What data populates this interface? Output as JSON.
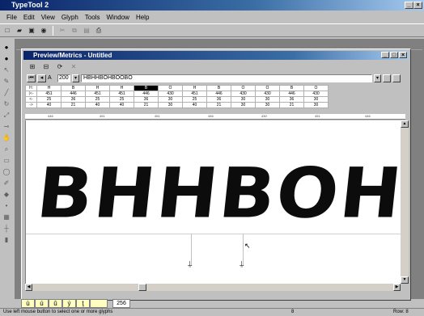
{
  "app": {
    "title": "TypeTool 2"
  },
  "menu": [
    "File",
    "Edit",
    "View",
    "Glyph",
    "Tools",
    "Window",
    "Help"
  ],
  "window": {
    "title": "Preview/Metrics - Untitled"
  },
  "preview": {
    "size_value": "200",
    "text_value": "HBHHBOHBOOBO",
    "specimen_text": "BHHBOHBO"
  },
  "metrics": {
    "row_labels": [
      "H:",
      "|<-",
      "<-",
      "->"
    ],
    "glyphs": [
      "H",
      "B",
      "H",
      "H",
      "B",
      "O",
      "H",
      "B",
      "O",
      "O",
      "B",
      "O"
    ],
    "widths": [
      "451",
      "446",
      "451",
      "451",
      "446",
      "430",
      "451",
      "446",
      "430",
      "430",
      "446",
      "430"
    ],
    "lsb": [
      "25",
      "36",
      "25",
      "25",
      "36",
      "30",
      "25",
      "36",
      "30",
      "30",
      "36",
      "30"
    ],
    "rsb": [
      "40",
      "21",
      "40",
      "40",
      "21",
      "30",
      "40",
      "21",
      "30",
      "30",
      "21",
      "30"
    ]
  },
  "ruler_ticks": [
    "446",
    "451",
    "451",
    "446",
    "430",
    "451",
    "446"
  ],
  "glyph_bar": {
    "chars": [
      "ù",
      "ú",
      "û",
      "ý",
      "ţ",
      ""
    ],
    "code": "256"
  },
  "status": {
    "left": "Use left mouse button to select one or more glyphs",
    "center": "8",
    "right": "Row: 8"
  }
}
